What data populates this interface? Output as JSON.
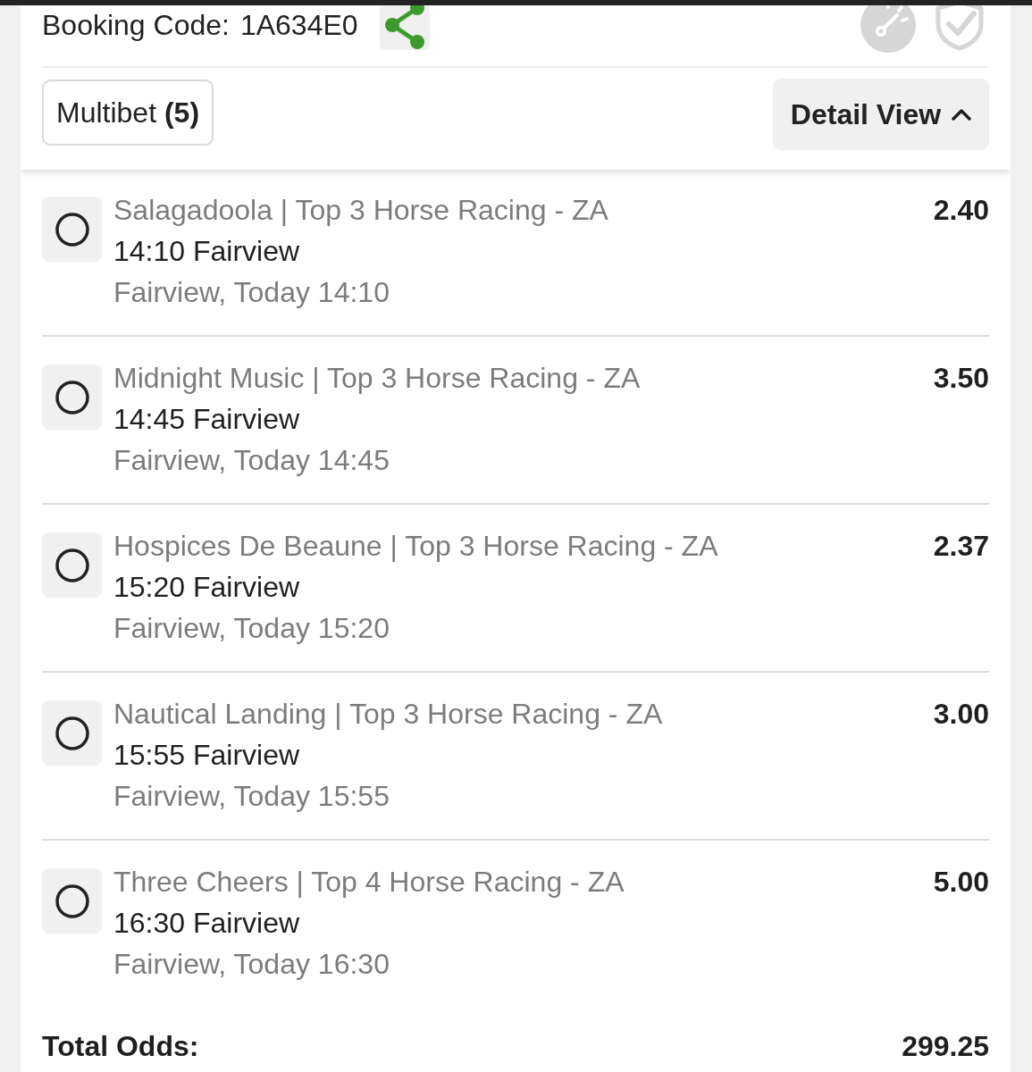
{
  "booking": {
    "label": "Booking Code:",
    "code": "1A634E0"
  },
  "bet_type": {
    "label": "Multibet **(5)**"
  },
  "view_toggle": {
    "label": "Detail View",
    "expanded": true
  },
  "selections": [
    {
      "selected": false,
      "title": "Salagadoola | Top 3 Horse Racing - ZA",
      "event": "14:10 Fairview",
      "time": "Fairview, Today 14:10",
      "odds": "2.40"
    },
    {
      "selected": false,
      "title": "Midnight Music | Top 3 Horse Racing - ZA",
      "event": "14:45 Fairview",
      "time": "Fairview, Today 14:45",
      "odds": "3.50"
    },
    {
      "selected": false,
      "title": "Hospices De Beaune | Top 3 Horse Racing - ZA",
      "event": "15:20 Fairview",
      "time": "Fairview, Today 15:20",
      "odds": "2.37"
    },
    {
      "selected": false,
      "title": "Nautical Landing | Top 3 Horse Racing - ZA",
      "event": "15:55 Fairview",
      "time": "Fairview, Today 15:55",
      "odds": "3.00"
    },
    {
      "selected": false,
      "title": "Three Cheers | Top 4 Horse Racing - ZA",
      "event": "16:30 Fairview",
      "time": "Fairview, Today 16:30",
      "odds": "5.00"
    }
  ],
  "total": {
    "label": "Total Odds:",
    "value": "299.25"
  }
}
